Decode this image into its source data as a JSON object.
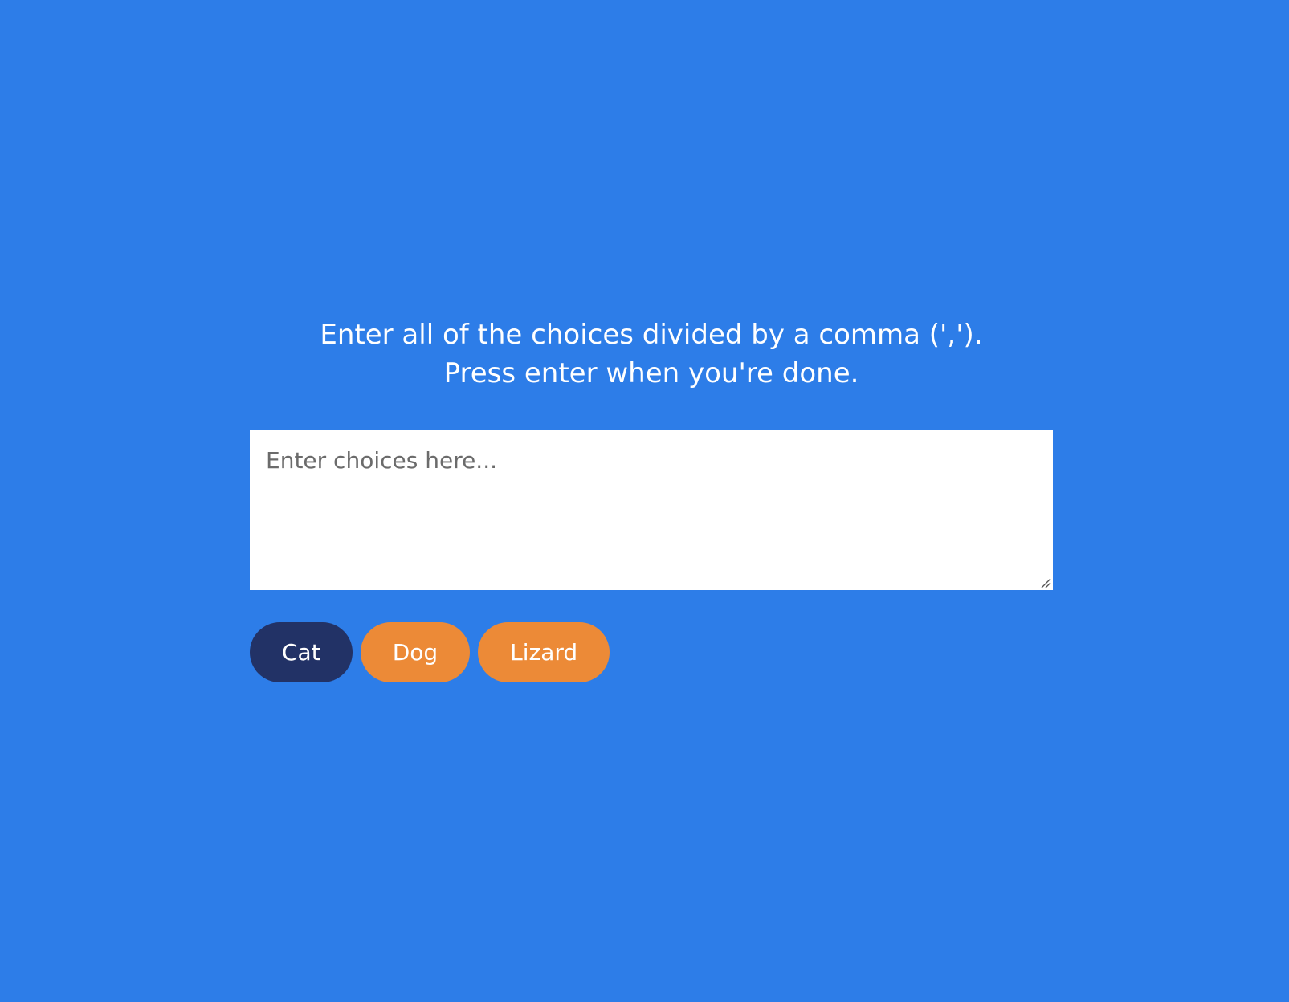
{
  "instructions": {
    "line1": "Enter all of the choices divided by a comma (',').",
    "line2": "Press enter when you're done."
  },
  "choices_input": {
    "value": "",
    "placeholder": "Enter choices here..."
  },
  "tags": [
    {
      "label": "Cat",
      "state": "highlighted",
      "color": "#223266"
    },
    {
      "label": "Dog",
      "state": "default",
      "color": "#ec8a37"
    },
    {
      "label": "Lizard",
      "state": "default",
      "color": "#ec8a37"
    }
  ],
  "colors": {
    "background": "#2d7de8",
    "tag_default": "#ec8a37",
    "tag_highlight": "#223266",
    "text": "#ffffff"
  }
}
